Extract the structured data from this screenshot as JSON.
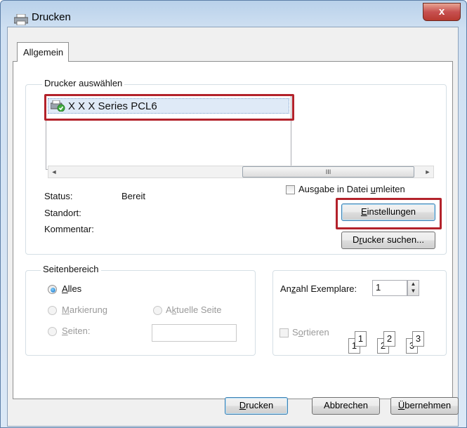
{
  "window": {
    "title": "Drucken",
    "close_glyph": "x"
  },
  "tabs": [
    {
      "label": "Allgemein"
    }
  ],
  "printer_group": {
    "legend": "Drucker auswählen",
    "printers": [
      {
        "name": "X X X Series PCL6",
        "icon": "printer-ready-icon"
      }
    ],
    "scroll_thumb_glyph": "III",
    "scroll_left_glyph": "◄",
    "scroll_right_glyph": "►",
    "status_label": "Status:",
    "status_value": "Bereit",
    "location_label": "Standort:",
    "location_value": "",
    "comment_label": "Kommentar:",
    "comment_value": "",
    "print_to_file": {
      "prefix": "Ausgabe in Datei ",
      "accel": "u",
      "suffix": "mleiten",
      "checked": false
    },
    "preferences_button": {
      "accel": "E",
      "rest": "instellungen"
    },
    "find_printer_button": {
      "pre": "D",
      "accel": "r",
      "rest": "ucker suchen..."
    }
  },
  "page_range_group": {
    "legend": "Seitenbereich",
    "all": {
      "accel": "A",
      "rest": "lles",
      "selected": true
    },
    "selection": {
      "accel": "M",
      "rest": "arkierung",
      "enabled": false
    },
    "current_page": {
      "pre": "A",
      "accel": "k",
      "rest": "tuelle Seite",
      "enabled": false
    },
    "pages": {
      "accel": "S",
      "rest": "eiten:",
      "enabled": false
    },
    "pages_value": ""
  },
  "copies_group": {
    "copies_label": {
      "pre": "An",
      "accel": "z",
      "rest": "ahl Exemplare:"
    },
    "copies_value": "1",
    "collate": {
      "pre": "S",
      "accel": "o",
      "rest": "rtieren",
      "checked": false,
      "enabled": false
    },
    "collate_pages": [
      [
        "1",
        "1"
      ],
      [
        "2",
        "2"
      ],
      [
        "3",
        "3"
      ]
    ]
  },
  "footer_buttons": {
    "print": {
      "accel": "D",
      "rest": "rucken"
    },
    "cancel": {
      "label": "Abbrechen"
    },
    "apply": {
      "accel": "Ü",
      "rest": "bernehmen"
    }
  },
  "colors": {
    "highlight_box": "#b3222b",
    "title_gradient": "#b9d1ea"
  }
}
